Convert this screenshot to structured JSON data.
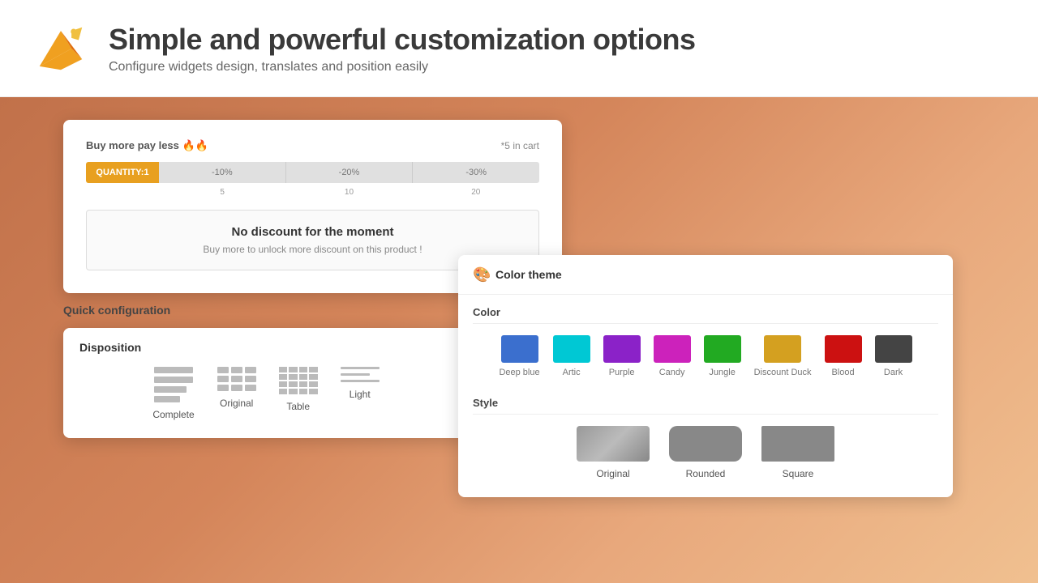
{
  "header": {
    "title": "Simple and powerful customization options",
    "subtitle": "Configure widgets design, translates and position easily",
    "logo_alt": "duck-logo"
  },
  "discount_widget": {
    "buy_more_label": "Buy more pay less 🔥🔥",
    "cart_count": "*5 in cart",
    "quantity_label": "QUANTITY:1",
    "progress_segments": [
      "-10%",
      "-20%",
      "-30%"
    ],
    "progress_ticks": [
      "5",
      "10",
      "20"
    ],
    "no_discount_title": "No discount for the moment",
    "no_discount_sub": "Buy more to unlock more discount on this product !"
  },
  "quick_config": {
    "label": "Quick configuration",
    "disposition_title": "Disposition",
    "options": [
      {
        "name": "Complete",
        "type": "complete"
      },
      {
        "name": "Original",
        "type": "original"
      },
      {
        "name": "Table",
        "type": "table"
      },
      {
        "name": "Light",
        "type": "light"
      }
    ]
  },
  "color_theme": {
    "panel_title": "Color theme",
    "color_section_label": "Color",
    "style_section_label": "Style",
    "colors": [
      {
        "name": "Deep blue",
        "hex": "#3b6fce"
      },
      {
        "name": "Artic",
        "hex": "#00c8d4"
      },
      {
        "name": "Purple",
        "hex": "#8b22c8"
      },
      {
        "name": "Candy",
        "hex": "#cc22bb"
      },
      {
        "name": "Jungle",
        "hex": "#22aa22"
      },
      {
        "name": "Discount Duck",
        "hex": "#d4a020"
      },
      {
        "name": "Blood",
        "hex": "#cc1111"
      },
      {
        "name": "Dark",
        "hex": "#444444"
      }
    ],
    "styles": [
      {
        "name": "Original",
        "type": "original"
      },
      {
        "name": "Rounded",
        "type": "rounded"
      },
      {
        "name": "Square",
        "type": "square"
      }
    ]
  }
}
